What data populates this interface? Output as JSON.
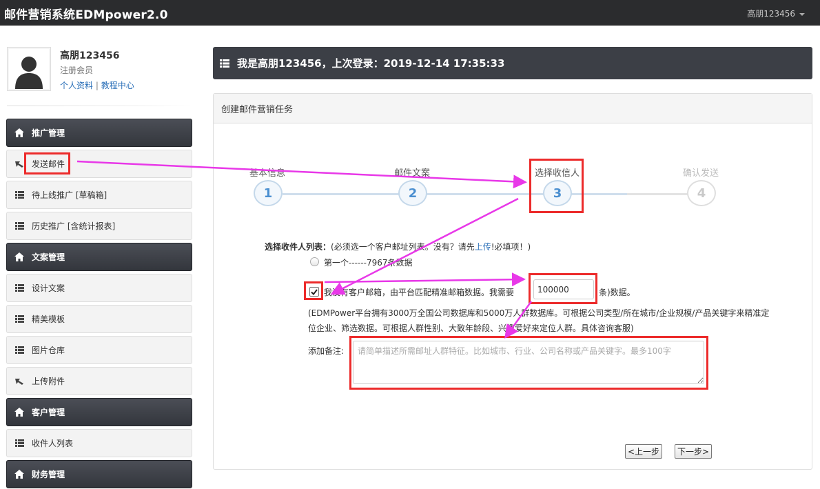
{
  "app": {
    "brand": "邮件营销系统EDMpower2.0",
    "user_menu": "高朋123456"
  },
  "user": {
    "name": "高朋123456",
    "role": "注册会员",
    "link_profile": "个人资料",
    "link_tutorial": "教程中心",
    "separator": "|"
  },
  "sidebar": {
    "items": [
      {
        "label": "推广管理",
        "type": "header",
        "icon": "home-icon"
      },
      {
        "label": "发送邮件",
        "type": "item",
        "icon": "cursor-icon"
      },
      {
        "label": "待上线推广 [草稿箱]",
        "type": "item",
        "icon": "list-icon"
      },
      {
        "label": "历史推广 [含统计报表]",
        "type": "item",
        "icon": "list-icon"
      },
      {
        "label": "文案管理",
        "type": "header",
        "icon": "home-icon"
      },
      {
        "label": "设计文案",
        "type": "item",
        "icon": "list-icon"
      },
      {
        "label": "精美模板",
        "type": "item",
        "icon": "list-icon"
      },
      {
        "label": "图片仓库",
        "type": "item",
        "icon": "list-icon"
      },
      {
        "label": "上传附件",
        "type": "item",
        "icon": "cursor-icon"
      },
      {
        "label": "客户管理",
        "type": "header",
        "icon": "home-icon"
      },
      {
        "label": "收件人列表",
        "type": "item",
        "icon": "list-icon"
      },
      {
        "label": "财务管理",
        "type": "header",
        "icon": "home-icon"
      }
    ]
  },
  "welcome": {
    "text": "我是高朋123456，上次登录：2019-12-14 17:35:33"
  },
  "panel": {
    "title": "创建邮件营销任务"
  },
  "steps": [
    {
      "number": "1",
      "label": "基本信息",
      "state": "done"
    },
    {
      "number": "2",
      "label": "邮件文案",
      "state": "done"
    },
    {
      "number": "3",
      "label": "选择收信人",
      "state": "active"
    },
    {
      "number": "4",
      "label": "确认发送",
      "state": "todo"
    }
  ],
  "form": {
    "list_label": "选择收件人列表：",
    "list_hint_prefix": "(必须选一个客户邮址列表。没有？请先",
    "list_hint_link": "上传",
    "list_hint_suffix": "!必填项！)",
    "option_label": "第一个------7967条数据",
    "no_list_text_a": "我没有客户邮箱，由平台匹配精准邮箱数据。我需要",
    "no_list_text_b": "条)数据。",
    "quantity_value": "100000",
    "info_line1": "(EDMPower平台拥有3000万全国公司数据库和5000万人群数据库。可根据公司类型/所在城市/企业规模/产品关键字来精准定",
    "info_line2": "位企业、筛选数据。可根据人群性别、大致年龄段、兴趣爱好来定位人群。具体咨询客服)",
    "note_label": "添加备注:",
    "note_placeholder": "请简单描述所需邮址人群特征。比如城市、行业、公司名称或产品关键字。最多100字",
    "prev_button": "<上一步",
    "next_button": "下一步>"
  },
  "colors": {
    "annotation_red": "#ec2b2b",
    "annotation_arrow": "#e838e8",
    "topbar": "#2b2c2e",
    "sidebar_header": "#3c3f46",
    "link": "#2a6fb8"
  }
}
